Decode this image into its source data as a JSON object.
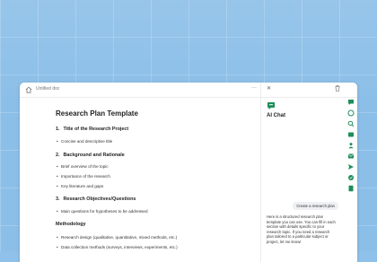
{
  "window": {
    "doc_title": "Untitled doc",
    "more_glyph": "···",
    "close_glyph": "✕"
  },
  "document": {
    "title": "Research Plan Template",
    "sections": [
      {
        "num": "1.",
        "title": "Title of the Research Project",
        "bullets": [
          "Concise and descriptive title"
        ]
      },
      {
        "num": "2.",
        "title": "Background and Rationale",
        "bullets": [
          "Brief overview of the topic",
          "Importance of the research",
          "Key literature and gaps"
        ]
      },
      {
        "num": "3.",
        "title": "Research Objectives/Questions",
        "bullets": [
          "Main questions for hypotheses to be addressed"
        ]
      }
    ],
    "methodology": {
      "title": "Methodology",
      "bullets": [
        "Research design (qualitative, quantitative, mixed methods, etc.)",
        "Data collection methods (surveys, interviews, experiments, etc.)"
      ]
    }
  },
  "chat": {
    "title": "AI Chat",
    "user_message": "Create a research plan",
    "ai_message": "Here is a structured research plan template you can use. You can fill in each section with details specific to your research topic. If you need a research plan tailored to a particular subject or project, let me know!"
  },
  "rail_icons": [
    "chat-icon",
    "link-icon",
    "search-icon",
    "image-icon",
    "person-icon",
    "mail-icon",
    "send-icon",
    "check-icon",
    "document-icon"
  ],
  "colors": {
    "accent": "#1e8e5a",
    "background": "#8cbfe8"
  }
}
